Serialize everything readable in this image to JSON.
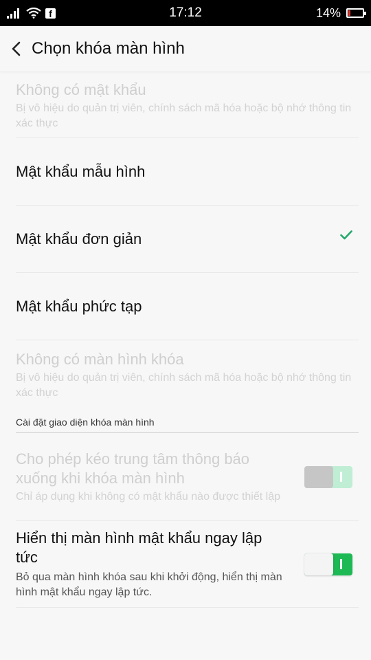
{
  "status": {
    "time": "17:12",
    "battery": "14%",
    "battery_level": 0.14,
    "icons": [
      "signal-icon",
      "wifi-icon",
      "facebook-icon",
      "battery-icon"
    ]
  },
  "header": {
    "title": "Chọn khóa màn hình",
    "back_icon": "chevron-left-icon"
  },
  "options": [
    {
      "title": "Không có mật khẩu",
      "subtitle": "Bị vô hiệu do quản trị viên, chính sách mã hóa hoặc bộ nhớ thông tin xác thực",
      "disabled": true
    },
    {
      "title": "Mật khẩu mẫu hình",
      "selected": false
    },
    {
      "title": "Mật khẩu đơn giản",
      "selected": true
    },
    {
      "title": "Mật khẩu phức tạp",
      "selected": false
    },
    {
      "title": "Không có màn hình khóa",
      "subtitle": "Bị vô hiệu do quản trị viên, chính sách mã hóa hoặc bộ nhớ thông tin xác thực",
      "disabled": true
    }
  ],
  "section": {
    "label": "Cài đặt giao diện khóa màn hình"
  },
  "toggles": [
    {
      "title": "Cho phép kéo trung tâm thông báo xuống khi khóa màn hình",
      "subtitle": "Chỉ áp dụng khi không có mật khẩu nào được thiết lập",
      "disabled": true,
      "on": true
    },
    {
      "title": "Hiển thị màn hình mật khẩu ngay lập tức",
      "subtitle": "Bỏ qua màn hình khóa sau khi khởi động, hiển thị màn hình mật khẩu ngay lập tức.",
      "disabled": false,
      "on": true
    }
  ],
  "colors": {
    "accent": "#1db954",
    "check": "#22a96b",
    "battery_low": "#e53935"
  }
}
